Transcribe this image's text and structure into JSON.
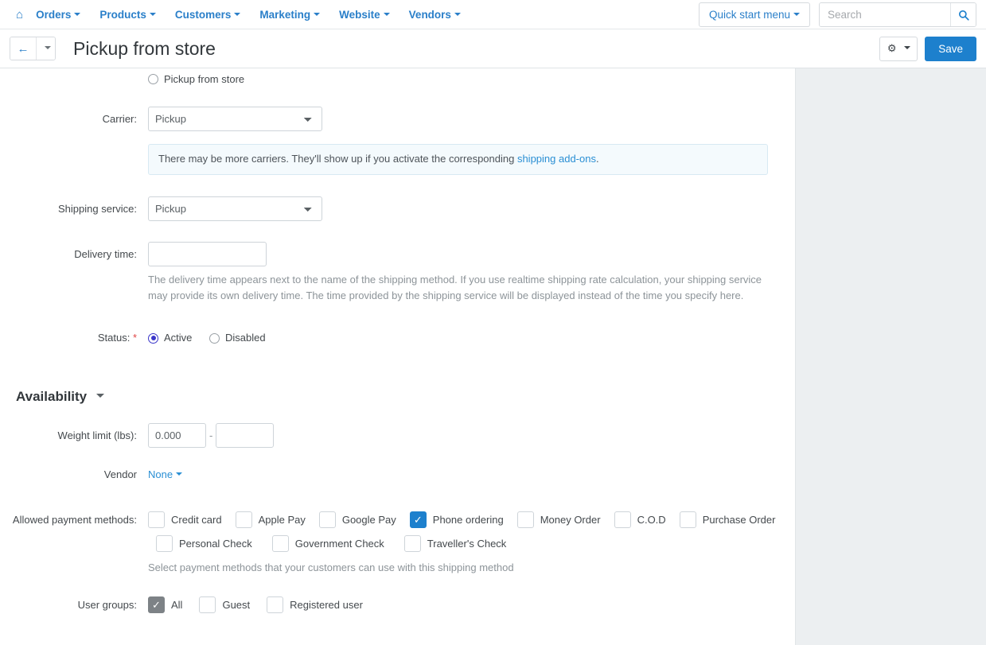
{
  "topnav": {
    "home_icon": "home-icon",
    "items": [
      {
        "label": "Orders"
      },
      {
        "label": "Products"
      },
      {
        "label": "Customers"
      },
      {
        "label": "Marketing"
      },
      {
        "label": "Website"
      },
      {
        "label": "Vendors"
      }
    ],
    "quick_start_label": "Quick start menu",
    "search_placeholder": "Search",
    "search_value": "",
    "search_icon": "search-icon"
  },
  "titlebar": {
    "back_icon": "arrow-left-icon",
    "back_caret_icon": "chevron-down-icon",
    "title": "Pickup from store",
    "gear_icon": "gear-icon",
    "gear_caret_icon": "chevron-down-icon",
    "save_label": "Save"
  },
  "form": {
    "top_radio": {
      "label": "Pickup from store",
      "checked": false
    },
    "carrier": {
      "label": "Carrier:",
      "value": "Pickup",
      "options": [
        "Pickup"
      ]
    },
    "carrier_notice": {
      "text_before": "There may be more carriers. They'll show up if you activate the corresponding ",
      "link": "shipping add-ons",
      "text_after": "."
    },
    "shipping_service": {
      "label": "Shipping service:",
      "value": "Pickup",
      "options": [
        "Pickup"
      ]
    },
    "delivery_time": {
      "label": "Delivery time:",
      "value": "",
      "help": "The delivery time appears next to the name of the shipping method. If you use realtime shipping rate calculation, your shipping service may provide its own delivery time. The time provided by the shipping service will be displayed instead of the time you specify here."
    },
    "status": {
      "label": "Status:",
      "required_mark": "*",
      "options": [
        {
          "label": "Active",
          "checked": true
        },
        {
          "label": "Disabled",
          "checked": false
        }
      ]
    }
  },
  "availability": {
    "section_label": "Availability",
    "weight_limit": {
      "label": "Weight limit (lbs):",
      "min_value": "0.000",
      "max_value": "",
      "separator": "-"
    },
    "vendor": {
      "label": "Vendor",
      "value": "None"
    },
    "payment_methods": {
      "label": "Allowed payment methods:",
      "row1": [
        {
          "label": "Credit card",
          "checked": false
        },
        {
          "label": "Apple Pay",
          "checked": false
        },
        {
          "label": "Google Pay",
          "checked": false
        },
        {
          "label": "Phone ordering",
          "checked": true
        },
        {
          "label": "Money Order",
          "checked": false
        },
        {
          "label": "C.O.D",
          "checked": false
        },
        {
          "label": "Purchase Order",
          "checked": false
        }
      ],
      "row2": [
        {
          "label": "Personal Check",
          "checked": false
        },
        {
          "label": "Government Check",
          "checked": false
        },
        {
          "label": "Traveller's Check",
          "checked": false
        }
      ],
      "help": "Select payment methods that your customers can use with this shipping method"
    },
    "user_groups": {
      "label": "User groups:",
      "items": [
        {
          "label": "All",
          "checked": true,
          "style": "grey"
        },
        {
          "label": "Guest",
          "checked": false,
          "style": "normal"
        },
        {
          "label": "Registered user",
          "checked": false,
          "style": "normal"
        }
      ]
    }
  },
  "colors": {
    "accent": "#1d80cd",
    "link": "#2a8fd4",
    "radio_active": "#3a36c9",
    "required": "#e04545",
    "page_bg": "#eceff1"
  }
}
